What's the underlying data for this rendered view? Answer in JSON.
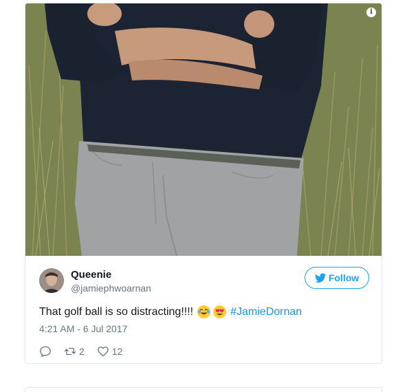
{
  "tweet": {
    "display_name": "Queenie",
    "handle": "@jamiephwoarnan",
    "follow_label": "Follow",
    "text": "That golf ball is so distracting!!!!",
    "hashtag": "#JamieDornan",
    "timestamp": "4:21 AM - 6 Jul 2017",
    "retweets": "2",
    "likes": "12"
  },
  "icons": {
    "info": "info-icon",
    "follow_bird": "twitter-bird-icon",
    "reply": "reply-icon",
    "retweet": "retweet-icon",
    "like": "heart-icon"
  },
  "colors": {
    "accent": "#1da1f2",
    "hashtag": "#1b95e0",
    "muted": "#657786",
    "border": "#e1e8ed"
  }
}
